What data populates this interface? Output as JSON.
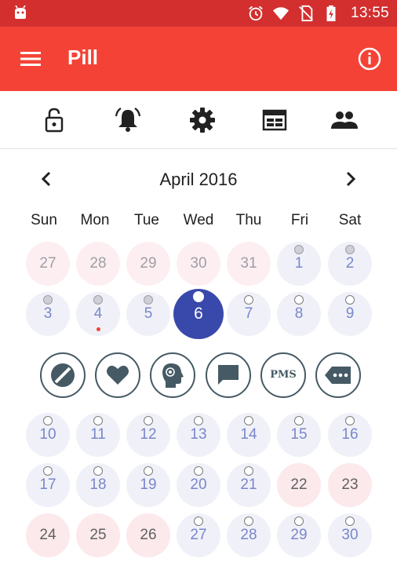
{
  "status_bar": {
    "time": "13:55",
    "icons": [
      "android-icon",
      "alarm-icon",
      "wifi-icon",
      "no-sim-icon",
      "battery-charging-icon"
    ]
  },
  "app_bar": {
    "title": "Pill",
    "left_icon": "menu-icon",
    "right_icon": "info-icon"
  },
  "toolbar": {
    "items": [
      "lock-open-icon",
      "alarm-bell-icon",
      "settings-gear-icon",
      "calendar-view-icon",
      "people-icon"
    ]
  },
  "calendar": {
    "month_label": "April 2016",
    "weekdays": [
      "Sun",
      "Mon",
      "Tue",
      "Wed",
      "Thu",
      "Fri",
      "Sat"
    ],
    "weeks": [
      [
        {
          "label": "27",
          "style": "other",
          "marker": "none"
        },
        {
          "label": "28",
          "style": "other",
          "marker": "none"
        },
        {
          "label": "29",
          "style": "other",
          "marker": "none"
        },
        {
          "label": "30",
          "style": "other",
          "marker": "none"
        },
        {
          "label": "31",
          "style": "other",
          "marker": "none"
        },
        {
          "label": "1",
          "style": "normal",
          "marker": "filled"
        },
        {
          "label": "2",
          "style": "normal",
          "marker": "filled"
        }
      ],
      [
        {
          "label": "3",
          "style": "normal",
          "marker": "filled"
        },
        {
          "label": "4",
          "style": "normal",
          "marker": "filled",
          "dot": true
        },
        {
          "label": "5",
          "style": "normal",
          "marker": "filled"
        },
        {
          "label": "6",
          "style": "today",
          "marker": "today"
        },
        {
          "label": "7",
          "style": "normal",
          "marker": "hollow"
        },
        {
          "label": "8",
          "style": "normal",
          "marker": "hollow"
        },
        {
          "label": "9",
          "style": "normal",
          "marker": "hollow"
        }
      ],
      [
        {
          "label": "10",
          "style": "normal",
          "marker": "hollow"
        },
        {
          "label": "11",
          "style": "normal",
          "marker": "hollow"
        },
        {
          "label": "12",
          "style": "normal",
          "marker": "hollow"
        },
        {
          "label": "13",
          "style": "normal",
          "marker": "hollow"
        },
        {
          "label": "14",
          "style": "normal",
          "marker": "hollow"
        },
        {
          "label": "15",
          "style": "normal",
          "marker": "hollow"
        },
        {
          "label": "16",
          "style": "normal",
          "marker": "hollow"
        }
      ],
      [
        {
          "label": "17",
          "style": "normal",
          "marker": "hollow"
        },
        {
          "label": "18",
          "style": "normal",
          "marker": "hollow"
        },
        {
          "label": "19",
          "style": "normal",
          "marker": "hollow"
        },
        {
          "label": "20",
          "style": "normal",
          "marker": "hollow"
        },
        {
          "label": "21",
          "style": "normal",
          "marker": "hollow"
        },
        {
          "label": "22",
          "style": "pink",
          "marker": "none"
        },
        {
          "label": "23",
          "style": "pink",
          "marker": "none"
        }
      ],
      [
        {
          "label": "24",
          "style": "pink",
          "marker": "none"
        },
        {
          "label": "25",
          "style": "pink",
          "marker": "none"
        },
        {
          "label": "26",
          "style": "pink",
          "marker": "none"
        },
        {
          "label": "27",
          "style": "normal",
          "marker": "hollow"
        },
        {
          "label": "28",
          "style": "normal",
          "marker": "hollow"
        },
        {
          "label": "29",
          "style": "normal",
          "marker": "hollow"
        },
        {
          "label": "30",
          "style": "normal",
          "marker": "hollow"
        }
      ]
    ]
  },
  "actions": {
    "pms_label": "PMS",
    "items": [
      "no-pill-icon",
      "heart-icon",
      "head-symptom-icon",
      "note-icon",
      "pms-icon",
      "more-tag-icon"
    ]
  },
  "colors": {
    "status_bar": "#d32f2f",
    "app_bar": "#f44336",
    "today": "#3949ab",
    "pill_day_bg": "#f0f1f8",
    "pill_day_text": "#7986cb",
    "period_day_bg": "#fbe9ec",
    "action_outline": "#455a64"
  }
}
